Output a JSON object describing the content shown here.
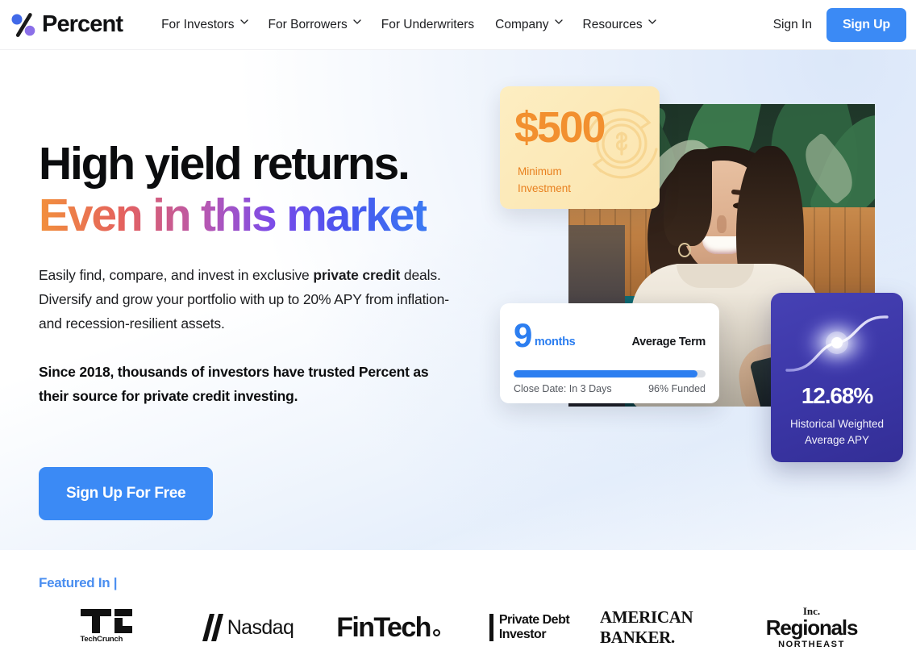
{
  "brand": {
    "name": "Percent",
    "logo_icon": "percent-logo-icon",
    "dot_blue": "#4169E8",
    "dot_purple": "#8B6FE8",
    "slash": "#1a1a1a"
  },
  "header": {
    "nav": [
      {
        "label": "For Investors",
        "has_dropdown": true
      },
      {
        "label": "For Borrowers",
        "has_dropdown": true
      },
      {
        "label": "For Underwriters",
        "has_dropdown": false
      },
      {
        "label": "Company",
        "has_dropdown": true
      },
      {
        "label": "Resources",
        "has_dropdown": true
      }
    ],
    "sign_in": "Sign In",
    "sign_up": "Sign Up",
    "accent_blue": "#3b8af5"
  },
  "hero": {
    "headline_line1": "High yield returns.",
    "headline_line2": "Even in this market",
    "headline_gradient": [
      "#f2903c",
      "#e4615f",
      "#b457b6",
      "#7c4ce8",
      "#4a54ef",
      "#3b79f2"
    ],
    "lede_1": "Easily find, compare, and invest in exclusive ",
    "lede_bold": "private credit",
    "lede_2": " deals. Diversify and grow your portfolio with up to 20% APY from inflation- and recession-resilient assets.",
    "lede_strong": "Since 2018, thousands of investors have trusted Percent as their source for private credit investing.",
    "cta": "Sign Up For Free",
    "photo_alt": "smiling-woman-using-phone"
  },
  "cards": {
    "minimum": {
      "amount": "$500",
      "label_line1": "Minimum",
      "label_line2": "Investment",
      "icon": "dollar-coin-refresh-icon",
      "bg": "#fbe5b0",
      "text_color": "#f2902f"
    },
    "term": {
      "number": "9",
      "unit": "months",
      "right_label": "Average Term",
      "progress_pct": 96,
      "close_date": "Close Date: In 3 Days",
      "funded": "96% Funded",
      "accent": "#2c7ef0"
    },
    "apy": {
      "value": "12.68%",
      "label_line1": "Historical Weighted",
      "label_line2": "Average APY",
      "icon": "glowing-s-curve-icon",
      "bg": "#3b36a6"
    }
  },
  "featured": {
    "title": "Featured In |",
    "logos": [
      {
        "name": "TechCrunch",
        "wordmark": "TechCrunch"
      },
      {
        "name": "Nasdaq",
        "wordmark": "Nasdaq"
      },
      {
        "name": "FinTech",
        "wordmark": "FinTech"
      },
      {
        "name": "Private Debt Investor",
        "line1": "Private Debt",
        "line2": "Investor"
      },
      {
        "name": "American Banker",
        "wordmark": "AMERICAN BANKER."
      },
      {
        "name": "Inc. Regionals Northeast",
        "top": "Inc.",
        "mid": "Regionals",
        "bottom": "NORTHEAST"
      }
    ]
  }
}
